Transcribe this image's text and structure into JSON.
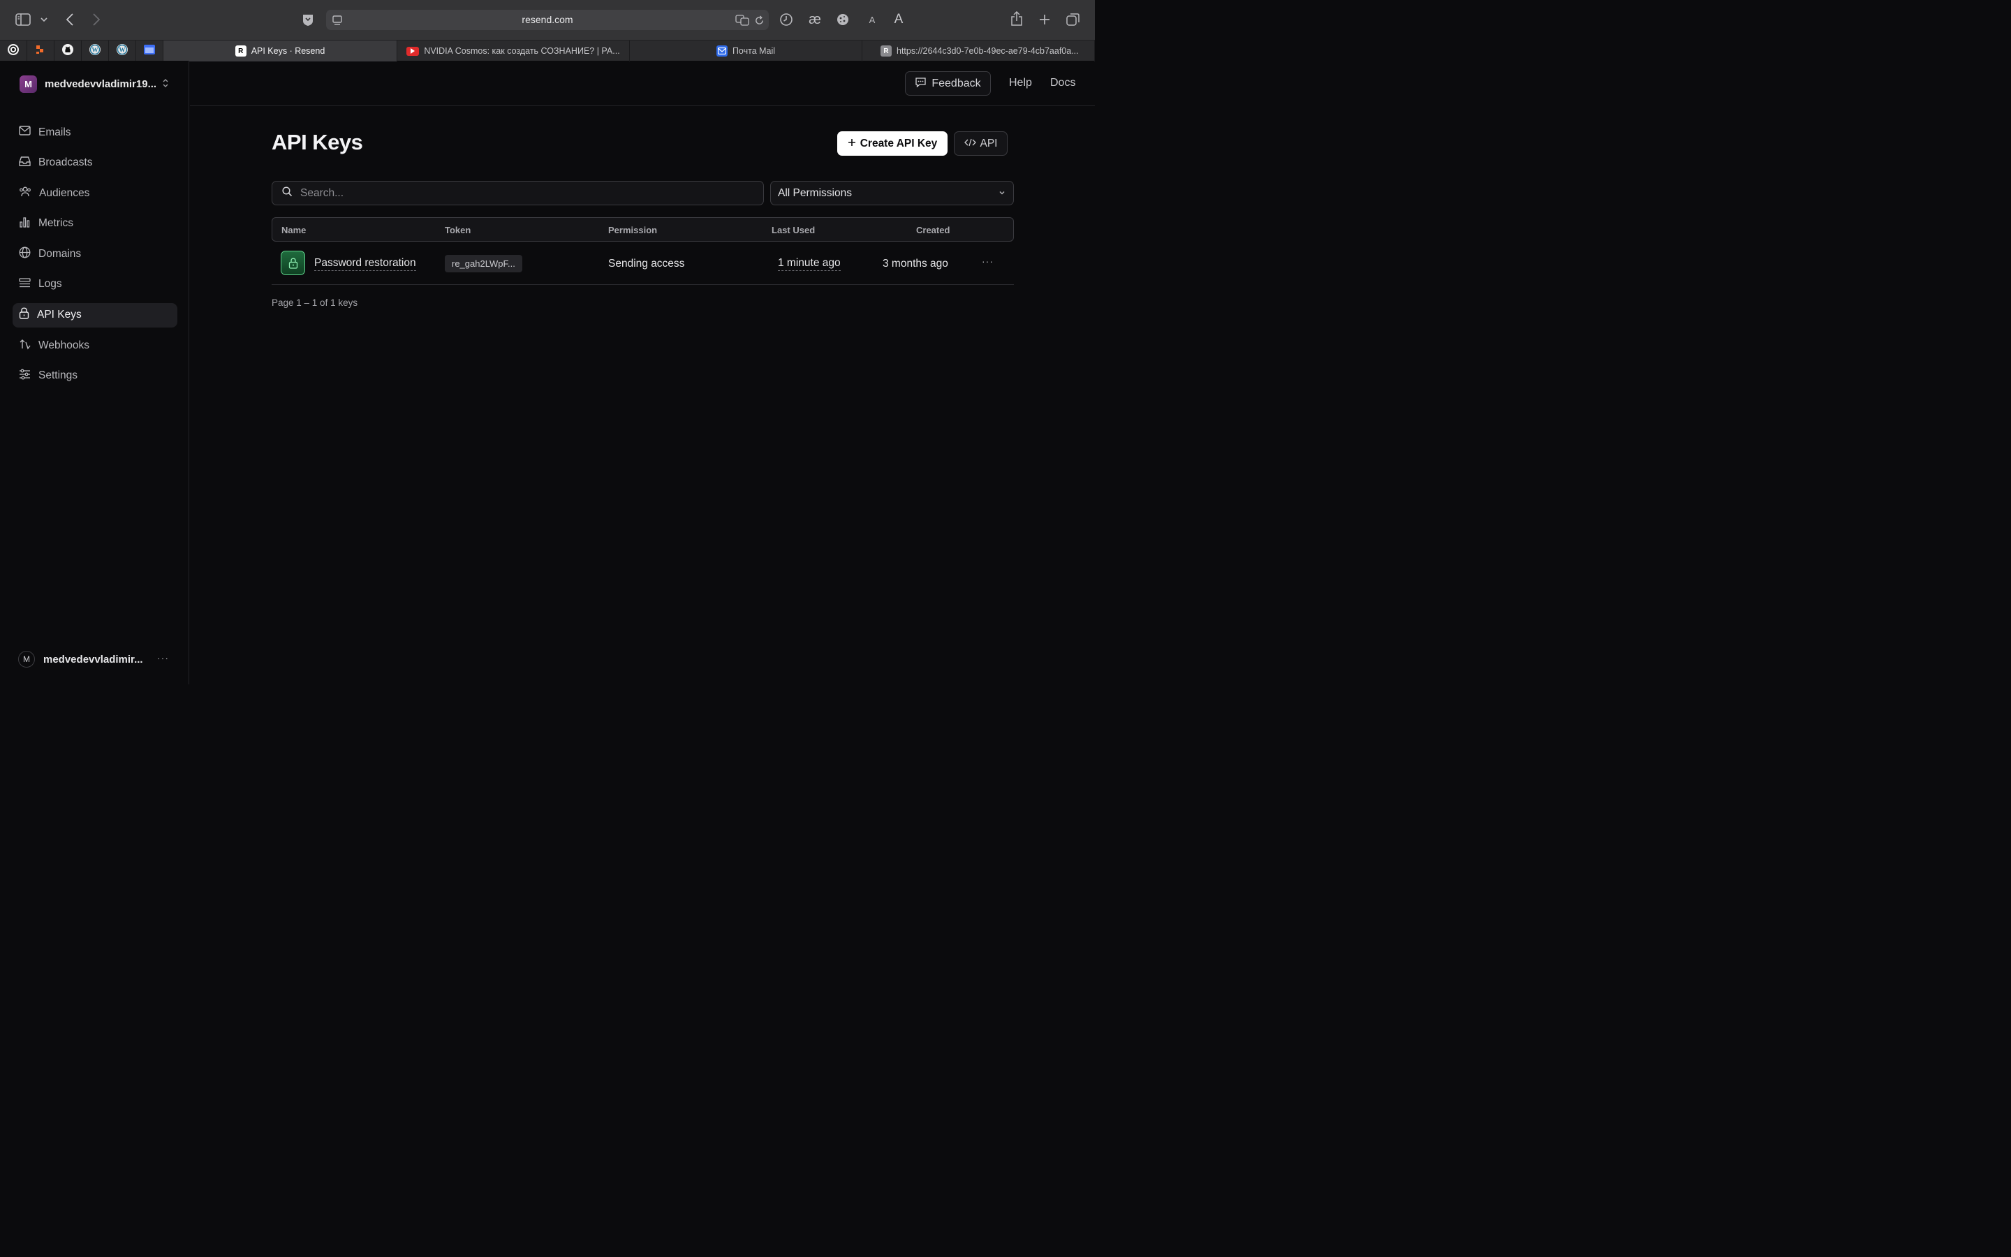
{
  "browser": {
    "address": "resend.com",
    "tabs": [
      {
        "title": "API Keys · Resend",
        "favicon": "R",
        "active": true
      },
      {
        "title": "NVIDIA Cosmos: как создать СОЗНАНИЕ? | РА...",
        "favicon": "youtube"
      },
      {
        "title": "Почта Mail",
        "favicon": "mail"
      },
      {
        "title": "https://2644c3d0-7e0b-49ec-ae79-4cb7aaf0a...",
        "favicon": "R"
      }
    ],
    "pinned": [
      "openai-icon",
      "orange-icon",
      "github-icon",
      "wordpress-icon",
      "wordpress-icon",
      "folder-icon"
    ]
  },
  "sidebar": {
    "team_initial": "M",
    "team_name": "medvedevvladimir19...",
    "items": [
      {
        "label": "Emails",
        "icon": "mail-icon"
      },
      {
        "label": "Broadcasts",
        "icon": "inbox-icon"
      },
      {
        "label": "Audiences",
        "icon": "users-icon"
      },
      {
        "label": "Metrics",
        "icon": "bar-chart-icon"
      },
      {
        "label": "Domains",
        "icon": "globe-icon"
      },
      {
        "label": "Logs",
        "icon": "logs-icon"
      },
      {
        "label": "API Keys",
        "icon": "lock-icon",
        "active": true
      },
      {
        "label": "Webhooks",
        "icon": "webhook-icon"
      },
      {
        "label": "Settings",
        "icon": "sliders-icon"
      }
    ],
    "user_initial": "M",
    "user_name": "medvedevvladimir..."
  },
  "topbar": {
    "feedback": "Feedback",
    "help": "Help",
    "docs": "Docs"
  },
  "page": {
    "title": "API Keys",
    "create_button": "Create API Key",
    "api_button": "API",
    "search_placeholder": "Search...",
    "filter_value": "All Permissions",
    "columns": [
      "Name",
      "Token",
      "Permission",
      "Last Used",
      "Created"
    ],
    "rows": [
      {
        "name": "Password restoration",
        "token": "re_gah2LWpF...",
        "permission": "Sending access",
        "last_used": "1 minute ago",
        "created": "3 months ago",
        "more": "···"
      }
    ],
    "pagination": "Page 1 – 1 of 1 keys"
  },
  "colors": {
    "background": "#0b0b0d",
    "accent_green": "#5fd08a",
    "primary_button": "#ffffff"
  }
}
